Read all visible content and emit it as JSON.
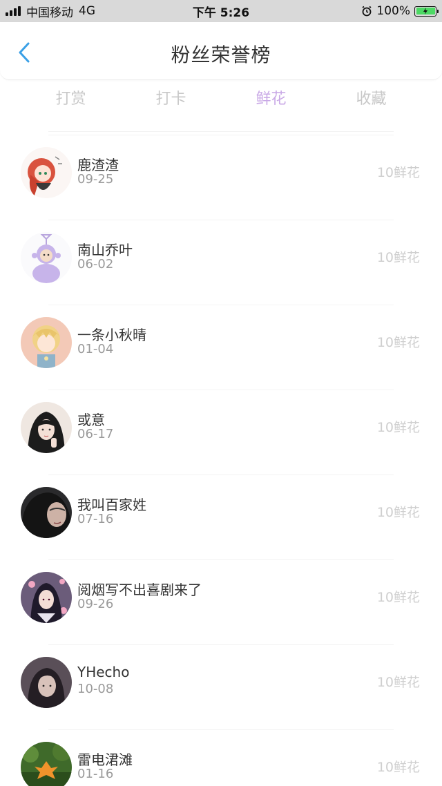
{
  "status_bar": {
    "carrier": "中国移动",
    "network": "4G",
    "time": "下午 5:26",
    "battery": "100%",
    "battery_level": 1.0
  },
  "header": {
    "title": "粉丝荣誉榜",
    "back_icon": "chevron-left-icon"
  },
  "tabs": [
    {
      "label": "打赏",
      "active": false
    },
    {
      "label": "打卡",
      "active": false
    },
    {
      "label": "鲜花",
      "active": true
    },
    {
      "label": "收藏",
      "active": false
    }
  ],
  "colors": {
    "accent": "#c9a9e6",
    "back_arrow": "#3aa0e6"
  },
  "fans": [
    {
      "name": "鹿渣渣",
      "date": "09-25",
      "count": "10鲜花",
      "avatar": "anime-girl-red-hair"
    },
    {
      "name": "南山乔叶",
      "date": "06-02",
      "count": "10鲜花",
      "avatar": "purple-teletubby"
    },
    {
      "name": "一条小秋晴",
      "date": "01-04",
      "count": "10鲜花",
      "avatar": "anime-boy-blond"
    },
    {
      "name": "或意",
      "date": "06-17",
      "count": "10鲜花",
      "avatar": "photo-girl"
    },
    {
      "name": "我叫百家姓",
      "date": "07-16",
      "count": "10鲜花",
      "avatar": "photo-dark-portrait"
    },
    {
      "name": "阅烟写不出喜剧来了",
      "date": "09-26",
      "count": "10鲜花",
      "avatar": "anime-dark-hair-flowers"
    },
    {
      "name": "YHecho",
      "date": "10-08",
      "count": "10鲜花",
      "avatar": "photo-boy"
    },
    {
      "name": "雷电涒滩",
      "date": "01-16",
      "count": "10鲜花",
      "avatar": "photo-leaf"
    }
  ]
}
